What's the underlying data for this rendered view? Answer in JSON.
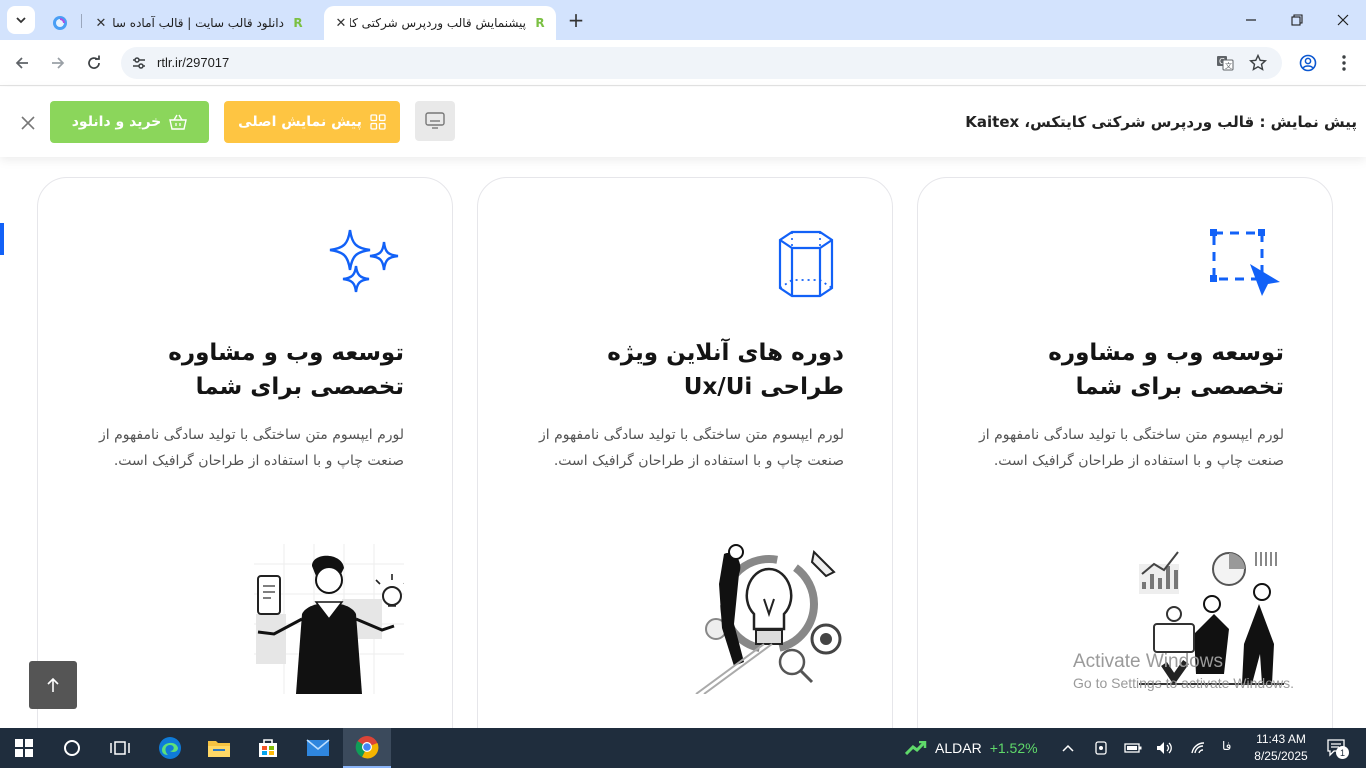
{
  "browser": {
    "tabs": [
      {
        "title": "",
        "favicon": "copilot-icon",
        "active": false
      },
      {
        "title": "دانلود قالب سایت | قالب آماده سا",
        "favicon": "rtl-theme-icon",
        "active": false
      },
      {
        "title": "پیشنمایش قالب وردپرس شرکتی کا",
        "favicon": "rtl-theme-icon",
        "active": true
      }
    ],
    "url": "rtlr.ir/297017"
  },
  "preview_bar": {
    "title": "پیش نمایش : قالب وردپرس شرکتی کایتکس، Kaitex",
    "buy_label": "خرید و دانلود",
    "demo_label": "پیش نمایش اصلی",
    "buy_color": "#8bd65b",
    "demo_color": "#fec542"
  },
  "cards": [
    {
      "icon": "selection-cursor-icon",
      "title": "توسعه وب و مشاوره تخصصی برای شما",
      "text": "لورم ایپسوم متن ساختگی با تولید سادگی نامفهوم از صنعت چاپ و با استفاده از طراحان گرافیک است.",
      "illustration": "team-analytics-illustration"
    },
    {
      "icon": "hexagon-prism-icon",
      "title": "دوره های آنلاین ویژه طراحی Ux/Ui",
      "text": "لورم ایپسوم متن ساختگی با تولید سادگی نامفهوم از صنعت چاپ و با استفاده از طراحان گرافیک است.",
      "illustration": "idea-growth-illustration"
    },
    {
      "icon": "sparkles-icon",
      "title": "توسعه وب و مشاوره تخصصی برای شما",
      "text": "لورم ایپسوم متن ساختگی با تولید سادگی نامفهوم از صنعت چاپ و با استفاده از طراحان گرافیک است.",
      "illustration": "thinking-man-illustration"
    }
  ],
  "accent_color": "#1261f7",
  "watermark": {
    "line1": "Activate Windows",
    "line2": "Go to Settings to activate Windows."
  },
  "taskbar": {
    "ticker_name": "ALDAR",
    "ticker_change": "+1.52%",
    "language": "فا",
    "time": "11:43 AM",
    "date": "8/25/2025",
    "notification_count": "1"
  }
}
